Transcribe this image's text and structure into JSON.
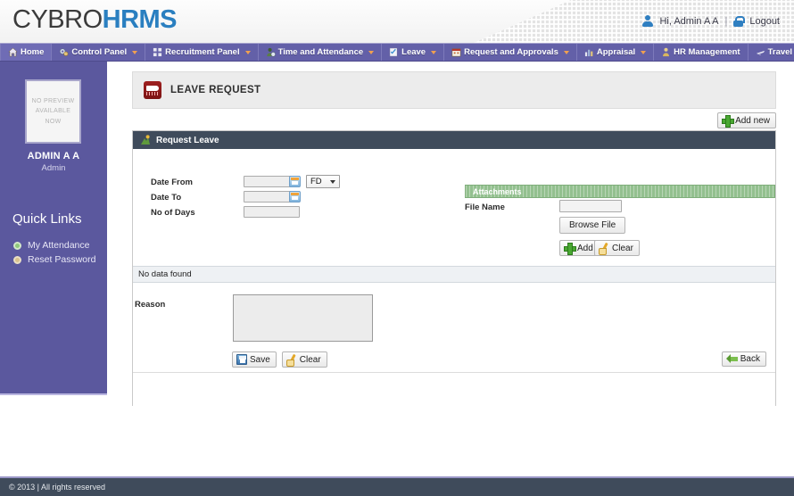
{
  "header": {
    "logo_primary": "CYBRO",
    "logo_secondary": "HRMS",
    "greeting": "Hi, Admin A A",
    "separator": "|",
    "logout_label": "Logout",
    "user_icon": "user-icon",
    "lock_icon": "lock-icon"
  },
  "nav": {
    "items": [
      {
        "label": "Home",
        "icon": "home-icon",
        "has_caret": false,
        "active": true
      },
      {
        "label": "Control Panel",
        "icon": "gears-icon",
        "has_caret": true,
        "active": false
      },
      {
        "label": "Recruitment Panel",
        "icon": "grid-icon",
        "has_caret": true,
        "active": false
      },
      {
        "label": "Time and Attendance",
        "icon": "person-clock-icon",
        "has_caret": true,
        "active": false
      },
      {
        "label": "Leave",
        "icon": "checklist-icon",
        "has_caret": true,
        "active": false
      },
      {
        "label": "Request and Approvals",
        "icon": "calendar-icon",
        "has_caret": true,
        "active": false
      },
      {
        "label": "Appraisal",
        "icon": "bar-chart-icon",
        "has_caret": true,
        "active": false
      },
      {
        "label": "HR Management",
        "icon": "person-icon",
        "has_caret": false,
        "active": false
      },
      {
        "label": "Travel and Accommodation",
        "icon": "plane-icon",
        "has_caret": false,
        "active": false
      }
    ]
  },
  "sidebar": {
    "avatar_text": "NO PREVIEW AVAILABLE NOW",
    "user_name": "ADMIN A A",
    "user_role": "Admin",
    "quick_links_title": "Quick Links",
    "quick_links": [
      {
        "label": "My Attendance",
        "bullet_color": "#8fc97c"
      },
      {
        "label": "Reset Password",
        "bullet_color": "#d9c28d"
      }
    ],
    "collapse_glyph": "‹"
  },
  "page": {
    "title": "LEAVE REQUEST",
    "title_icon": "leave-request-icon",
    "add_new_label": "Add new",
    "add_new_icon": "plus-icon"
  },
  "panel": {
    "heading": "Request Leave",
    "heading_icon": "request-leave-icon",
    "fields": {
      "date_from_label": "Date From",
      "date_from_value": "",
      "date_to_label": "Date To",
      "date_to_value": "",
      "no_of_days_label": "No of Days",
      "no_of_days_value": "",
      "duration_selected": "FD",
      "duration_options": [
        "FD"
      ],
      "calendar_icon": "calendar-picker-icon"
    },
    "attachments": {
      "section_title": "Attachments",
      "file_name_label": "File Name",
      "file_name_value": "",
      "browse_label": "Browse File",
      "add_label": "Add",
      "add_icon": "plus-icon",
      "clear_label": "Clear",
      "clear_icon": "eraser-icon"
    },
    "grid": {
      "empty_message": "No data found"
    },
    "reason_label": "Reason",
    "reason_value": "",
    "actions": {
      "save_label": "Save",
      "save_icon": "save-icon",
      "clear_label": "Clear",
      "clear_icon": "eraser-icon",
      "back_label": "Back",
      "back_icon": "back-arrow-icon"
    }
  },
  "footer": {
    "text": "© 2013 | All rights reserved"
  },
  "colors": {
    "nav_purple": "#6360a8",
    "sidebar_purple": "#5b589e",
    "panel_dark": "#3f4b5b",
    "attachment_green": "#93c08f",
    "brand_blue": "#2a7fc0"
  }
}
